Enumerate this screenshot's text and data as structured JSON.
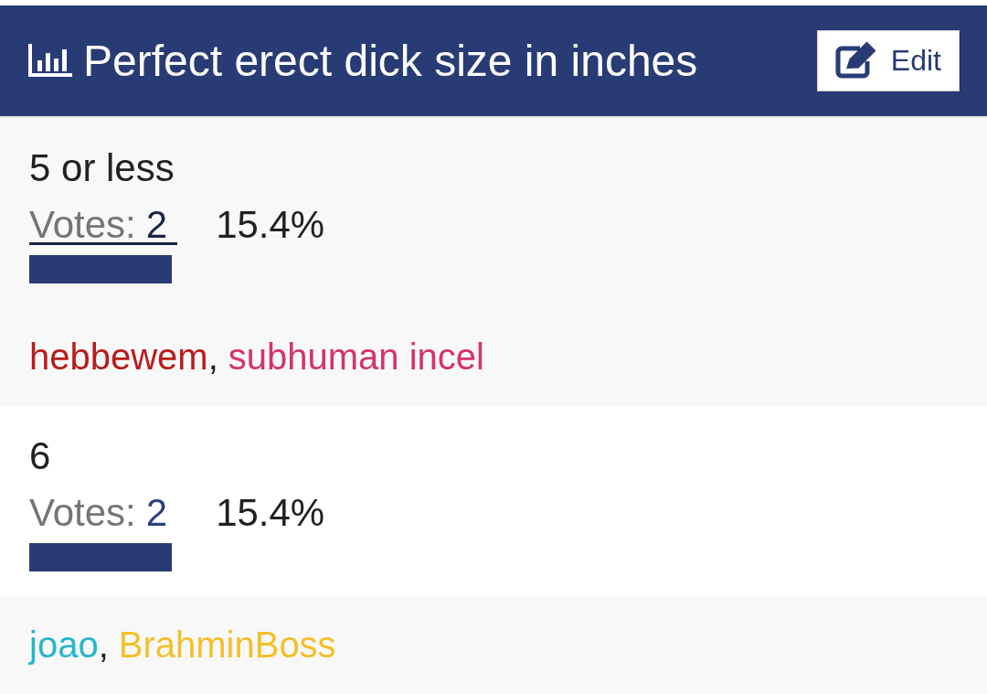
{
  "header": {
    "title": "Perfect erect dick size in inches",
    "edit_label": "Edit"
  },
  "options": [
    {
      "label": "5 or less",
      "votes_label": "Votes:",
      "votes_count": "2",
      "votes_focused": true,
      "percent": "15.4%",
      "level": 0.154,
      "separator": ",",
      "voters": [
        {
          "name": "hebbewem",
          "color": "#b71c1c"
        },
        {
          "name": "subhuman incel",
          "color": "#d4336b"
        }
      ]
    },
    {
      "label": "6",
      "votes_label": "Votes:",
      "votes_count": "2",
      "votes_focused": false,
      "percent": "15.4%",
      "level": 0.154,
      "separator": ",",
      "voters": [
        {
          "name": "joao",
          "color": "#26b6cc"
        },
        {
          "name": "BrahminBoss",
          "color": "#f3c02b"
        }
      ]
    }
  ]
}
